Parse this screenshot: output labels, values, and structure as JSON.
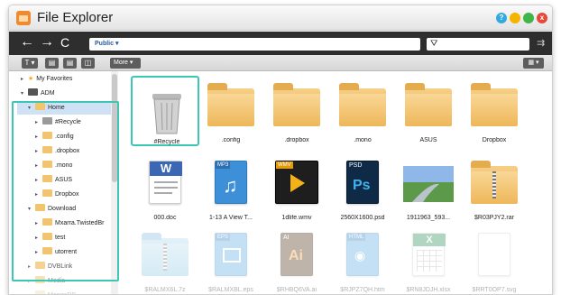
{
  "window": {
    "title": "File Explorer",
    "controls": [
      {
        "name": "help-button",
        "glyph": "?",
        "color": "#33aadd"
      },
      {
        "name": "minimize-button",
        "glyph": "",
        "color": "#f4b400"
      },
      {
        "name": "maximize-button",
        "glyph": "",
        "color": "#3fb54a"
      },
      {
        "name": "close-button",
        "glyph": "x",
        "color": "#e8483b"
      }
    ]
  },
  "navbar": {
    "back_glyph": "←",
    "forward_glyph": "→",
    "refresh_glyph": "C",
    "path": "Public ▾",
    "filter_glyph": "⛛",
    "right_glyph": "⇉"
  },
  "toolbar": {
    "more_label": "More ▾",
    "view_label": "▦ ▾"
  },
  "sidebar": {
    "items": [
      {
        "label": "My Favorites",
        "arrow": "▸",
        "icon": "star"
      },
      {
        "label": "ADM",
        "arrow": "▾",
        "icon": "dark"
      },
      {
        "label": "Home",
        "arrow": "▾",
        "icon": "folder"
      },
      {
        "label": "#Recycle",
        "arrow": "▸",
        "icon": "gray"
      },
      {
        "label": ".config",
        "arrow": "▸",
        "icon": "folder"
      },
      {
        "label": ".dropbox",
        "arrow": "▸",
        "icon": "folder"
      },
      {
        "label": ".mono",
        "arrow": "▸",
        "icon": "folder"
      },
      {
        "label": "ASUS",
        "arrow": "▸",
        "icon": "folder"
      },
      {
        "label": "Dropbox",
        "arrow": "▸",
        "icon": "folder"
      },
      {
        "label": "Download",
        "arrow": "▾",
        "icon": "folder"
      },
      {
        "label": "Mxarra.TwistedBr",
        "arrow": "▸",
        "icon": "folder"
      },
      {
        "label": "test",
        "arrow": "▸",
        "icon": "folder"
      },
      {
        "label": "utorrent",
        "arrow": "▸",
        "icon": "folder"
      },
      {
        "label": "DVBLink",
        "arrow": "▸",
        "icon": "folder"
      },
      {
        "label": "Media",
        "arrow": "▸",
        "icon": "folder"
      },
      {
        "label": "MongoDB",
        "arrow": "▸",
        "icon": "folder"
      }
    ]
  },
  "files": [
    {
      "label": "#Recycle",
      "type": "recycle"
    },
    {
      "label": ".config",
      "type": "folder"
    },
    {
      "label": ".dropbox",
      "type": "folder"
    },
    {
      "label": ".mono",
      "type": "folder"
    },
    {
      "label": "ASUS",
      "type": "folder"
    },
    {
      "label": "Dropbox",
      "type": "folder"
    },
    {
      "label": "000.doc",
      "type": "word"
    },
    {
      "label": "1-13 A View T...",
      "type": "mp3"
    },
    {
      "label": "1dlife.wmv",
      "type": "video"
    },
    {
      "label": "2560X1600.psd",
      "type": "psd"
    },
    {
      "label": "1911963_593...",
      "type": "image"
    },
    {
      "label": "$R03PJY2.rar",
      "type": "zip"
    },
    {
      "label": "$RALMX6L.7z",
      "type": "zipfolder"
    },
    {
      "label": "$RALMXBL.eps",
      "type": "eps"
    },
    {
      "label": "$RHBQ6VA.ai",
      "type": "ai"
    },
    {
      "label": "$RJPZ7QH.htm",
      "type": "html"
    },
    {
      "label": "$RN8JDJH.xlsx",
      "type": "excel"
    },
    {
      "label": "$RRT0OP7.svg",
      "type": "blank"
    }
  ],
  "colors": {
    "accent": "#3cc6b4",
    "navbar": "#2e2e2e",
    "folder": "#f0bc63"
  }
}
